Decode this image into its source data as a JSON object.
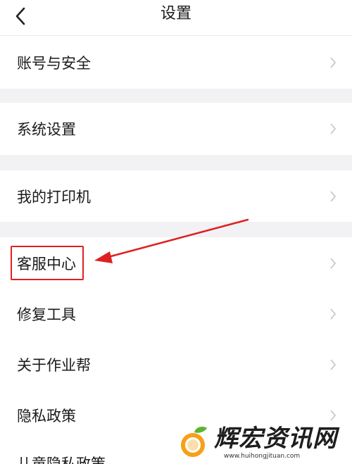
{
  "header": {
    "title": "设置"
  },
  "groups": [
    {
      "items": [
        {
          "label": "账号与安全"
        }
      ]
    },
    {
      "items": [
        {
          "label": "系统设置"
        }
      ]
    },
    {
      "items": [
        {
          "label": "我的打印机"
        }
      ]
    },
    {
      "items": [
        {
          "label": "客服中心"
        },
        {
          "label": "修复工具"
        },
        {
          "label": "关于作业帮"
        },
        {
          "label": "隐私政策"
        },
        {
          "label": "儿童隐私政策"
        }
      ]
    }
  ],
  "annotation": {
    "highlight_color": "#e02020",
    "target": "客服中心"
  },
  "watermark": {
    "brand": "辉宏资讯网",
    "url": "www.huihongjituan.com"
  }
}
